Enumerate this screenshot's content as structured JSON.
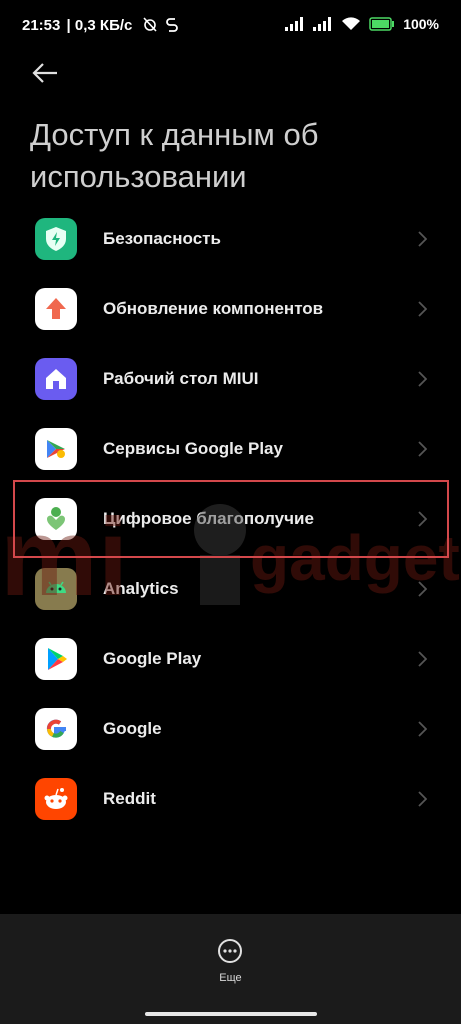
{
  "status_bar": {
    "time": "21:53",
    "speed": "| 0,3 КБ/с",
    "battery": "100%"
  },
  "header": {
    "title": "Доступ к данным об использовании"
  },
  "apps": [
    {
      "label": "Безопасность",
      "icon": "security-shield-icon"
    },
    {
      "label": "Обновление компонентов",
      "icon": "update-arrow-icon"
    },
    {
      "label": "Рабочий стол MIUI",
      "icon": "home-icon"
    },
    {
      "label": "Сервисы Google Play",
      "icon": "puzzle-icon"
    },
    {
      "label": "Цифровое благополучие",
      "icon": "wellbeing-icon"
    },
    {
      "label": "Analytics",
      "icon": "android-icon"
    },
    {
      "label": "Google Play",
      "icon": "play-store-icon"
    },
    {
      "label": "Google",
      "icon": "google-g-icon"
    },
    {
      "label": "Reddit",
      "icon": "reddit-icon"
    }
  ],
  "bottom_bar": {
    "more_label": "Еще"
  },
  "watermark": {
    "text": "mi gadget"
  },
  "colors": {
    "background": "#000000",
    "bottom_bar": "#1b1b1b",
    "highlight": "#d3484b"
  }
}
